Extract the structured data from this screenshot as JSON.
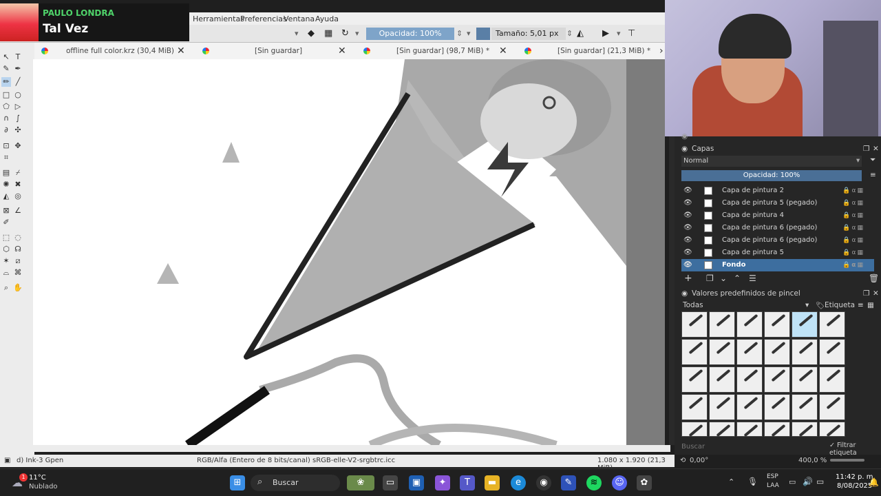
{
  "menu": {
    "items": [
      "Herramientas",
      "Preferencias",
      "Ventana",
      "Ayuda"
    ]
  },
  "tool_options": {
    "opacity": "Opacidad: 100%",
    "size": "Tamaño: 5,01 px"
  },
  "tabs": [
    {
      "label": "offline full color.krz (30,4 MiB)"
    },
    {
      "label": "[Sin guardar]"
    },
    {
      "label": "[Sin guardar]  (98,7 MiB) *"
    },
    {
      "label": "[Sin guardar]  (21,3 MiB) *"
    }
  ],
  "now_playing": {
    "artist": "PAULO LONDRA",
    "song": "Tal Vez"
  },
  "layers_panel": {
    "title": "Capas",
    "blend_mode": "Normal",
    "opacity": "Opacidad:  100%",
    "layers": [
      {
        "name": "Capa de pintura 2",
        "active": false
      },
      {
        "name": "Capa de pintura 5 (pegado)",
        "active": false
      },
      {
        "name": "Capa de pintura 4",
        "active": false
      },
      {
        "name": "Capa de pintura 6 (pegado)",
        "active": false
      },
      {
        "name": "Capa de pintura 6 (pegado)",
        "active": false
      },
      {
        "name": "Capa de pintura 5",
        "active": false
      },
      {
        "name": "Fondo",
        "active": true
      }
    ]
  },
  "brush_presets": {
    "title": "Valores predefinidos de pincel",
    "filter": "Todas",
    "tag": "Etiqueta",
    "search_placeholder": "Buscar",
    "filter_tag_label": "Filtrar etiqueta",
    "rotation": "0,00°",
    "zoom": "400,0 %"
  },
  "status_bar": {
    "brush": "d) Ink-3 Gpen",
    "color_info": "RGB/Alfa (Entero de 8 bits/canal)  sRGB-elle-V2-srgbtrc.icc",
    "dims": "1.080 x 1.920 (21,3 MiB)"
  },
  "taskbar": {
    "weather_temp": "11°C",
    "weather_desc": "Nublado",
    "weather_badge": "1",
    "search_label": "Buscar",
    "lang": "ESP",
    "lang2": "LAA",
    "time": "11:42 p. m.",
    "date": "8/08/2025"
  },
  "colors": {
    "accent": "#3d6e9f",
    "opacity_bar": "#4a6f96",
    "spotify_green": "#1ed760"
  }
}
